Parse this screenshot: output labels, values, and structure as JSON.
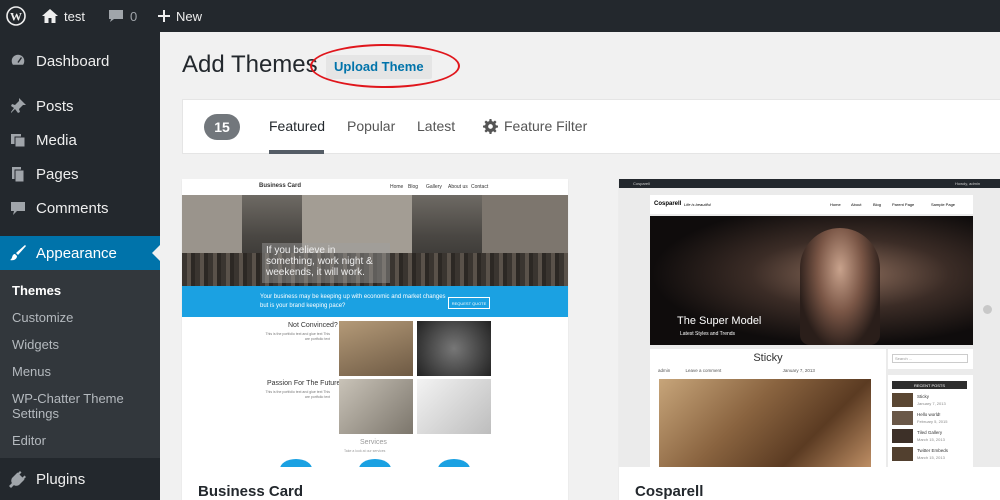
{
  "admin_bar": {
    "site_name": "test",
    "comments_count": "0",
    "new_label": "New"
  },
  "sidebar": {
    "items": [
      {
        "label": "Dashboard",
        "icon": "dashboard-icon"
      },
      {
        "label": "Posts",
        "icon": "pin-icon"
      },
      {
        "label": "Media",
        "icon": "media-icon"
      },
      {
        "label": "Pages",
        "icon": "pages-icon"
      },
      {
        "label": "Comments",
        "icon": "comment-icon"
      },
      {
        "label": "Appearance",
        "icon": "brush-icon",
        "current": true
      },
      {
        "label": "Plugins",
        "icon": "plug-icon"
      }
    ],
    "submenu": [
      {
        "label": "Themes",
        "current": true
      },
      {
        "label": "Customize"
      },
      {
        "label": "Widgets"
      },
      {
        "label": "Menus"
      },
      {
        "label": "WP-Chatter Theme Settings"
      },
      {
        "label": "Editor"
      }
    ]
  },
  "page": {
    "title": "Add Themes",
    "upload_button": "Upload Theme"
  },
  "filter_bar": {
    "count": "15",
    "tabs": [
      {
        "label": "Featured",
        "active": true
      },
      {
        "label": "Popular"
      },
      {
        "label": "Latest"
      },
      {
        "label": "Feature Filter",
        "icon": "gear-icon"
      }
    ]
  },
  "themes": [
    {
      "name": "Business Card",
      "preview": {
        "site_title": "Business Card",
        "nav": [
          "Home",
          "Blog",
          "Gallery",
          "About us",
          "Contact"
        ],
        "hero_quote": "If you believe in something, work night & weekends, it will work.",
        "band_text": "Your business may be keeping up with economic and market changes but is your brand keeping pace?",
        "band_button": "REQUEST QUOTE",
        "section1": "Not Convinced?",
        "section2": "Passion For The Future",
        "services": "Services",
        "services_sub": "Take a look at our services"
      }
    },
    {
      "name": "Cosparell",
      "preview": {
        "admin_site": "Cosparell",
        "admin_user": "Howdy, admin",
        "logo": "Cosparell",
        "tagline": "Life is beautiful",
        "nav": [
          "Home",
          "About",
          "Blog",
          "Parent Page",
          "Sample Page"
        ],
        "hero_title": "The Super Model",
        "hero_sub": "Latest Styles and Trends",
        "post_title": "Sticky",
        "post_author": "admin",
        "post_comment": "Leave a comment",
        "post_date": "January 7, 2013",
        "search_placeholder": "Search ...",
        "recent_heading": "RECENT POSTS",
        "recent_posts": [
          {
            "title": "Sticky",
            "date": "January 7, 2013"
          },
          {
            "title": "Hello world!",
            "date": "February 5, 2015"
          },
          {
            "title": "Tiled Gallery",
            "date": "March 15, 2013"
          },
          {
            "title": "Twitter Embeds",
            "date": "March 15, 2013"
          }
        ]
      }
    }
  ],
  "colors": {
    "admin_bg": "#23282d",
    "accent": "#0073aa",
    "annotation": "#e0161c"
  }
}
